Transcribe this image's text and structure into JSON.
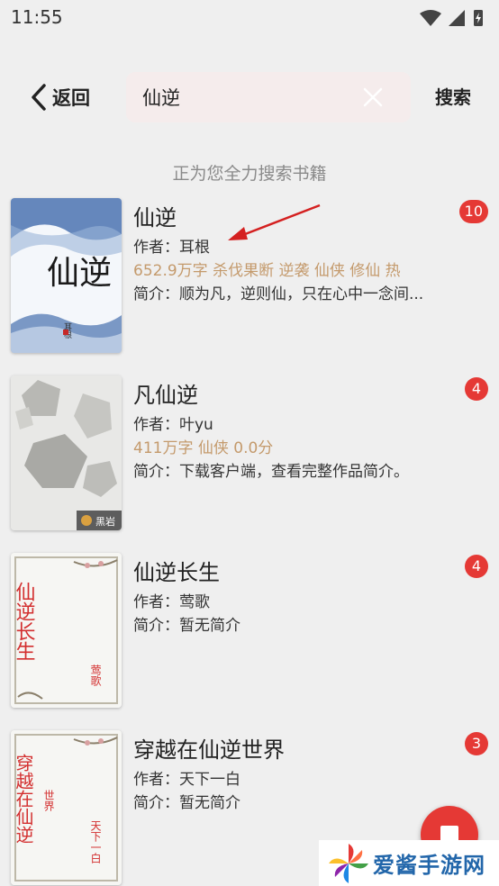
{
  "status_bar": {
    "time": "11:55",
    "icons": [
      "wifi-icon",
      "signal-icon",
      "battery-charging-icon"
    ]
  },
  "header": {
    "back_label": "返回",
    "search_value": "仙逆",
    "search_button_label": "搜索"
  },
  "searching_text": "正为您全力搜索书籍",
  "books": [
    {
      "title": "仙逆",
      "author": "作者：耳根",
      "meta": "652.9万字  杀伐果断  逆袭  仙侠  修仙  热",
      "intro": "简介：顺为凡，逆则仙，只在心中一念间...",
      "count": "10",
      "cover_text": "仙逆",
      "cover_author": "耳根"
    },
    {
      "title": "凡仙逆",
      "author": "作者：叶yu",
      "meta": "411万字  仙侠  0.0分",
      "intro": "简介：下载客户端，查看完整作品简介。",
      "count": "4",
      "cover_text": "黑岩"
    },
    {
      "title": "仙逆长生",
      "author": "作者：莺歌",
      "intro": "简介：暂无简介",
      "count": "4",
      "cover_text": "仙逆长生",
      "cover_author": "莺歌"
    },
    {
      "title": "穿越在仙逆世界",
      "author": "作者：天下一白",
      "intro": "简介：暂无简介",
      "count": "3",
      "cover_text": "穿越在仙逆",
      "cover_sub": "世界",
      "cover_author": "天下一白"
    }
  ],
  "watermark": "爱酱手游网",
  "colors": {
    "accent": "#e53935",
    "meta": "#c49a6c",
    "background": "#efefef",
    "search_bg": "#f5ecec",
    "annotation_arrow": "#d42020"
  }
}
